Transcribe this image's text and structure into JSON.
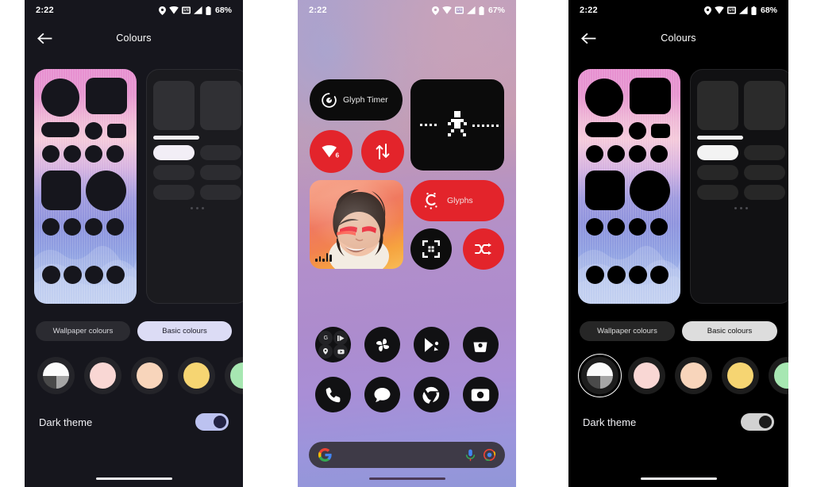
{
  "panels": [
    {
      "id": "settings-dark-theme-on",
      "statusbar": {
        "time": "2:22",
        "battery": "68%",
        "icons": [
          "location-icon",
          "wifi-icon",
          "sim-card-icon",
          "signal-bars-icon",
          "battery-icon"
        ]
      },
      "appbar": {
        "title": "Colours",
        "back_icon": "back-arrow-icon"
      },
      "segmented": {
        "options": [
          "Wallpaper colours",
          "Basic colours"
        ],
        "selected": "Basic colours"
      },
      "dark_theme": {
        "label": "Dark theme",
        "enabled": true
      },
      "swatches": [
        {
          "name": "monochrome",
          "type": "quad"
        },
        {
          "name": "pink",
          "color": "#f9d7d4"
        },
        {
          "name": "peach",
          "color": "#f8d5bb"
        },
        {
          "name": "yellow",
          "color": "#f6d572"
        },
        {
          "name": "green",
          "color": "#a7e7b2"
        }
      ],
      "selected_swatch": null,
      "previews": {
        "wallpaper_label": "wallpaper-preview",
        "icons_label": "icon-preview"
      }
    },
    {
      "id": "home-screen",
      "statusbar": {
        "time": "2:22",
        "battery": "67%",
        "icons": [
          "location-icon",
          "wifi-icon",
          "sim-card-icon",
          "signal-bars-icon",
          "battery-icon"
        ]
      },
      "widgets": [
        {
          "name": "glyph-timer-widget",
          "label": "Glyph Timer",
          "color": "#0c0c0c"
        },
        {
          "name": "glyph-matrix-widget",
          "label": "",
          "color": "#0b0b0b"
        },
        {
          "name": "wifi-toggle",
          "label": "6",
          "color": "#e3242b"
        },
        {
          "name": "mobile-data-toggle",
          "label": "",
          "color": "#e3242b"
        },
        {
          "name": "photo-widget",
          "label": ""
        },
        {
          "name": "glyphs-widget",
          "label": "Glyphs",
          "color": "#e3242b"
        },
        {
          "name": "qr-scanner-shortcut",
          "label": "",
          "color": "#0d0d0d"
        },
        {
          "name": "shuffle-shortcut",
          "label": "",
          "color": "#e3242b"
        }
      ],
      "apps": [
        {
          "name": "google-folder",
          "label": ""
        },
        {
          "name": "photos-app",
          "label": ""
        },
        {
          "name": "play-store-app",
          "label": ""
        },
        {
          "name": "shop-app",
          "label": ""
        },
        {
          "name": "phone-app",
          "label": ""
        },
        {
          "name": "messages-app",
          "label": ""
        },
        {
          "name": "chrome-app",
          "label": ""
        },
        {
          "name": "camera-app",
          "label": ""
        }
      ],
      "search": {
        "placeholder": "",
        "left_icon": "google-g-icon",
        "mic_icon": "microphone-icon",
        "lens_icon": "google-lens-icon"
      }
    },
    {
      "id": "settings-dark-theme-off",
      "statusbar": {
        "time": "2:22",
        "battery": "68%",
        "icons": [
          "location-icon",
          "wifi-icon",
          "sim-card-icon",
          "signal-bars-icon",
          "battery-icon"
        ]
      },
      "appbar": {
        "title": "Colours",
        "back_icon": "back-arrow-icon"
      },
      "segmented": {
        "options": [
          "Wallpaper colours",
          "Basic colours"
        ],
        "selected": "Basic colours"
      },
      "dark_theme": {
        "label": "Dark theme",
        "enabled": false
      },
      "swatches": [
        {
          "name": "monochrome",
          "type": "quad"
        },
        {
          "name": "pink",
          "color": "#f9d7d4"
        },
        {
          "name": "peach",
          "color": "#f8d5bb"
        },
        {
          "name": "yellow",
          "color": "#f6d572"
        },
        {
          "name": "green",
          "color": "#a7e7b2"
        }
      ],
      "selected_swatch": "monochrome"
    }
  ]
}
